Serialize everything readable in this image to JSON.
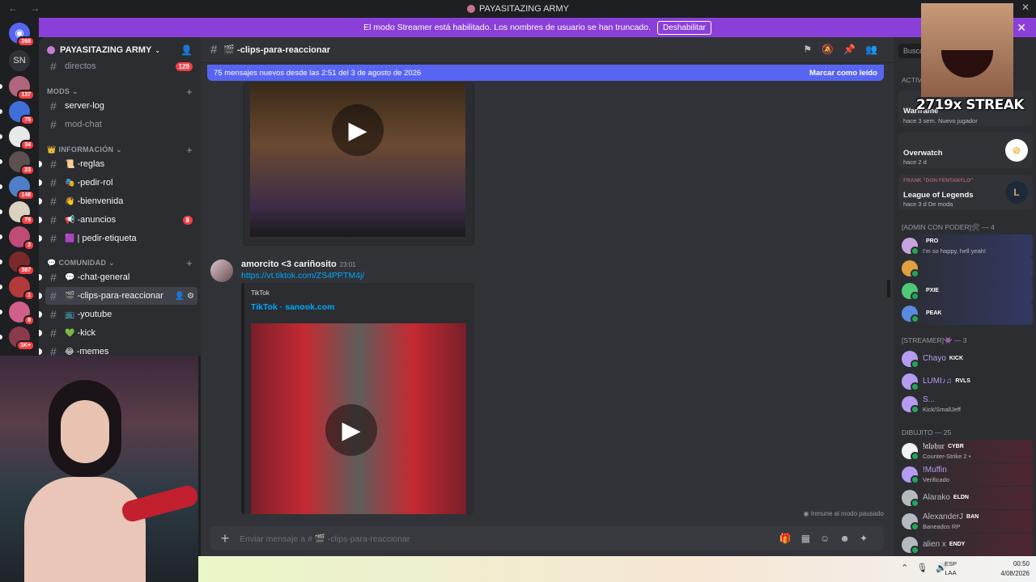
{
  "window": {
    "title": "PAYASITAZING ARMY"
  },
  "banner": {
    "text": "El modo Streamer está habilitado. Los nombres de usuario se han truncado.",
    "button": "Deshabilitar"
  },
  "rail": {
    "home_badge": "268",
    "sn_label": "SN",
    "servers": [
      {
        "badge": "137",
        "color": "#b0667d"
      },
      {
        "badge": "75",
        "color": "#3f6fd9"
      },
      {
        "badge": "34",
        "color": "#e8e8e8"
      },
      {
        "badge": "23",
        "color": "#5c5050"
      },
      {
        "badge": "148",
        "color": "#4f7fc8"
      },
      {
        "badge": "79",
        "color": "#d9d2c0"
      },
      {
        "badge": "3",
        "color": "#c04a78"
      },
      {
        "badge": "387",
        "color": "#7a2a2a"
      },
      {
        "badge": "1",
        "color": "#b33a3a"
      },
      {
        "badge": "8",
        "color": "#d0608a"
      },
      {
        "badge": "1K+",
        "color": "#8a3a4a"
      }
    ]
  },
  "sidebar": {
    "guild_name": "PAYASITAZING ARMY",
    "channels_top": [
      {
        "name": "directos",
        "badge": "129"
      }
    ],
    "cat_mods": "MODS",
    "mods": [
      {
        "name": "server-log",
        "unread": true
      },
      {
        "name": "mod-chat",
        "unread": false
      }
    ],
    "cat_info": "INFORMACIÓN",
    "info": [
      {
        "emoji": "📜",
        "name": "-reglas",
        "badge": ""
      },
      {
        "emoji": "🎭",
        "name": "-pedir-rol",
        "badge": ""
      },
      {
        "emoji": "👋",
        "name": "-bienvenida",
        "badge": ""
      },
      {
        "emoji": "📢",
        "name": "-anuncios",
        "badge": "8"
      },
      {
        "emoji": "🟪",
        "name": "| pedir-etiqueta",
        "badge": ""
      }
    ],
    "cat_com": "COMUNIDAD",
    "comunidad": [
      {
        "emoji": "💬",
        "name": "-chat-general",
        "active": false
      },
      {
        "emoji": "🎬",
        "name": "-clips-para-reaccionar",
        "active": true
      },
      {
        "emoji": "📺",
        "name": "-youtube",
        "active": false
      },
      {
        "emoji": "💚",
        "name": "-kick",
        "active": false
      },
      {
        "emoji": "😂",
        "name": "-memes",
        "active": false
      }
    ]
  },
  "chat": {
    "channel": "-clips-para-reaccionar",
    "new_messages": "75 mensajes nuevos desde las 2:51 del 3 de agosto de 2026",
    "mark_read": "Marcar como leído",
    "message": {
      "author": "amorcito <3 cariñosito",
      "time": "23:01",
      "link": "https://vt.tiktok.com/ZS4PPTM4j/",
      "provider": "TikTok",
      "embed_title": "TikTok · sanook.com"
    },
    "paused": "Inmune al modo pausado",
    "composer_placeholder": "Enviar mensaje a # 🎬 -clips-para-reaccionar"
  },
  "members": {
    "search_placeholder": "Buscar",
    "activity_header": "Activi",
    "activities": [
      {
        "user": "",
        "game": "Warframe",
        "sub": "hace 3 sem.  Nuevo jugador"
      },
      {
        "user": "",
        "game": "Overwatch",
        "sub": "hace 2 d"
      },
      {
        "user": "FRANK \"DON FENTANYLO\"",
        "game": "League of Legends",
        "sub": "hace 3 d  De moda"
      }
    ],
    "roles": [
      {
        "header": "[ADMIN CON PODER]🛠 — 4",
        "members": [
          {
            "name": "",
            "tag": "PRO",
            "status": "I'm so happy, hell yeah!",
            "color": "#c9a2e0"
          },
          {
            "name": "",
            "tag": "",
            "status": "",
            "color": "#e0a040"
          },
          {
            "name": "",
            "tag": "PXIE",
            "status": "",
            "color": "#50c878"
          },
          {
            "name": "",
            "tag": "PEAK",
            "status": "",
            "color": "#5a8ae0"
          }
        ]
      },
      {
        "header": "[STREAMER]👾 — 3",
        "members": [
          {
            "name": "Chayo",
            "tag": "KICK",
            "status": "",
            "color": "#b59cf0"
          },
          {
            "name": "LUMI♪♫",
            "tag": "RVLS",
            "status": "",
            "color": "#b59cf0"
          },
          {
            "name": "S...",
            "tag": "",
            "status": "Kick/SmallJeff",
            "color": "#b59cf0"
          }
        ]
      },
      {
        "header": "DIBUJITO — 25",
        "members": [
          {
            "name": "!𝔞𝔩𝔭𝔥𝔶𝔯",
            "tag": "CYBR",
            "status": "Counter-Strike 2 •",
            "color": "#f2f3f5"
          },
          {
            "name": "!Muffin",
            "tag": "",
            "status": "Verificado",
            "color": "#b59cf0"
          },
          {
            "name": "Alarako",
            "tag": "ELDN",
            "status": "",
            "color": "#b5bac1"
          },
          {
            "name": "AlexanderJ",
            "tag": "BAN",
            "status": "Baneados RP",
            "color": "#b5bac1"
          },
          {
            "name": "alien x",
            "tag": "ENDY",
            "status": "",
            "color": "#b5bac1"
          }
        ]
      }
    ]
  },
  "overlay": {
    "streak": "2719x STREAK"
  },
  "taskbar": {
    "lang1": "ESP",
    "lang2": "LAA",
    "time": "00:50",
    "date": "4/08/2026"
  },
  "colors": {
    "accent": "#5865f2",
    "banner": "#8b3fd9",
    "danger": "#f23f43",
    "link": "#00a8fc"
  }
}
